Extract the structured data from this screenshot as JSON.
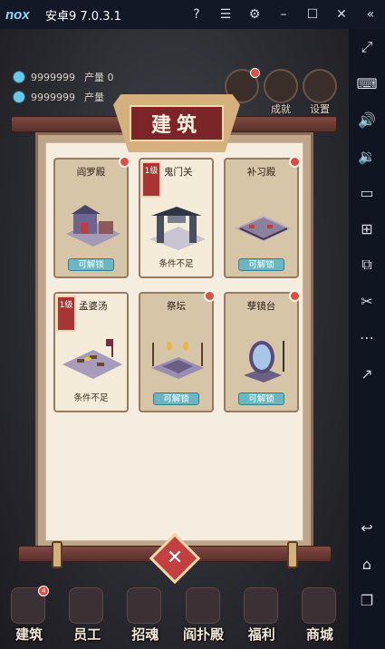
{
  "titlebar": {
    "logo": "nox",
    "title": "安卓9 7.0.3.1"
  },
  "game": {
    "resources": [
      {
        "value": "9999999",
        "label": "产量 0"
      },
      {
        "value": "9999999",
        "label": "产量"
      }
    ],
    "top_icons": [
      {
        "label": "",
        "has_dot": true
      },
      {
        "label": "成就",
        "has_dot": false
      },
      {
        "label": "设置",
        "has_dot": false
      }
    ],
    "panel": {
      "title": "建筑",
      "buildings": [
        {
          "name": "阎罗殿",
          "level": "",
          "action": "可解锁",
          "action_state": "unlock",
          "has_dot": true
        },
        {
          "name": "鬼门关",
          "level": "1级",
          "action": "条件不足",
          "action_state": "locked",
          "has_dot": false
        },
        {
          "name": "补习殿",
          "level": "",
          "action": "可解锁",
          "action_state": "unlock",
          "has_dot": true
        },
        {
          "name": "孟婆汤",
          "level": "1级",
          "action": "条件不足",
          "action_state": "locked",
          "has_dot": false
        },
        {
          "name": "祭坛",
          "level": "",
          "action": "可解锁",
          "action_state": "unlock",
          "has_dot": true
        },
        {
          "name": "孽镜台",
          "level": "",
          "action": "可解锁",
          "action_state": "unlock",
          "has_dot": true
        }
      ]
    },
    "bottom_nav": [
      {
        "label": "建筑",
        "badge": "4"
      },
      {
        "label": "员工",
        "badge": ""
      },
      {
        "label": "招魂",
        "badge": ""
      },
      {
        "label": "阎扑殿",
        "badge": ""
      },
      {
        "label": "福利",
        "badge": ""
      },
      {
        "label": "商城",
        "badge": ""
      }
    ]
  },
  "sidebar": {
    "buttons": [
      "expand-icon",
      "keyboard-icon",
      "volume-up-icon",
      "volume-down-icon",
      "screen-icon",
      "apk-icon",
      "layers-icon",
      "scissors-icon",
      "more-icon",
      "open-icon",
      "back-icon",
      "home-icon",
      "recent-apps-icon"
    ]
  },
  "colors": {
    "titlebar_bg": "#121826",
    "panel_bg": "#f5eee0",
    "card_bg": "#d7c5a8",
    "unlock_btn": "#6cb6c2",
    "badge_red": "#a83434",
    "notify_red": "#dd4d45"
  }
}
